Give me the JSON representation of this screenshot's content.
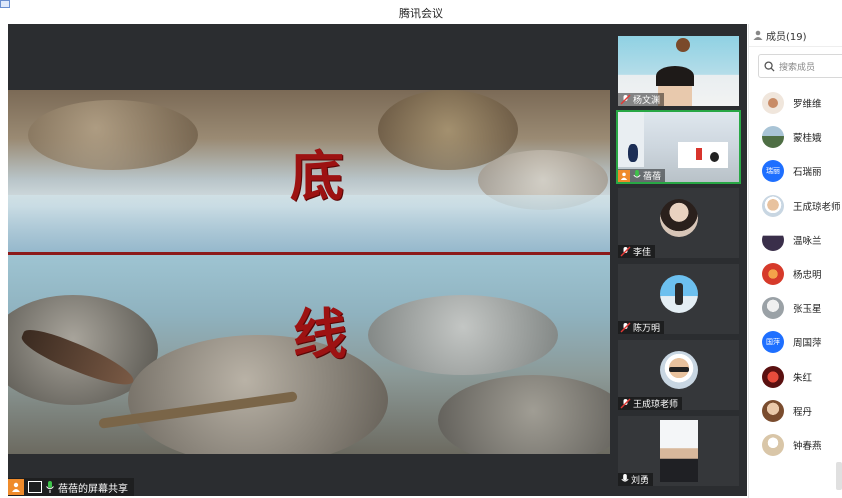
{
  "window": {
    "title": "腾讯会议"
  },
  "shared_screen": {
    "char_top": "底",
    "char_bottom": "线",
    "status_label": "蓓蓓的屏幕共享"
  },
  "gallery": {
    "tiles": [
      {
        "name": "杨文渊",
        "kind": "video",
        "muted": true
      },
      {
        "name": "蓓蓓",
        "kind": "video",
        "muted": false,
        "active": true,
        "sharing": true
      },
      {
        "name": "李佳",
        "kind": "avatar",
        "muted": true
      },
      {
        "name": "陈万明",
        "kind": "avatar",
        "muted": true
      },
      {
        "name": "王成琼老师",
        "kind": "avatar",
        "muted": true
      },
      {
        "name": "刘勇",
        "kind": "avatar",
        "muted": false
      }
    ]
  },
  "members": {
    "header": "成员(19)",
    "search_placeholder": "搜索成员",
    "list": [
      {
        "name": "罗维维",
        "avatar_text": "",
        "color": "#f0e6dc"
      },
      {
        "name": "蒙桂娥",
        "avatar_text": "",
        "color": "#6e8a64"
      },
      {
        "name": "石瑞丽",
        "avatar_text": "瑞丽",
        "color": "#1e6fff"
      },
      {
        "name": "王成琼老师",
        "avatar_text": "",
        "color": "#c7a38c"
      },
      {
        "name": "温咏兰",
        "avatar_text": "",
        "color": "#3a2f4a"
      },
      {
        "name": "杨忠明",
        "avatar_text": "",
        "color": "#d63a2a"
      },
      {
        "name": "张玉星",
        "avatar_text": "",
        "color": "#c6c9cc"
      },
      {
        "name": "周国萍",
        "avatar_text": "国萍",
        "color": "#1e6fff"
      },
      {
        "name": "朱红",
        "avatar_text": "",
        "color": "#8a1a1a"
      },
      {
        "name": "程丹",
        "avatar_text": "",
        "color": "#b78560"
      },
      {
        "name": "钟春燕",
        "avatar_text": "",
        "color": "#d9c6a8"
      }
    ]
  },
  "colors": {
    "accent": "#1e6fff",
    "active_border": "#28a745",
    "share_orange": "#ef8b2b"
  }
}
